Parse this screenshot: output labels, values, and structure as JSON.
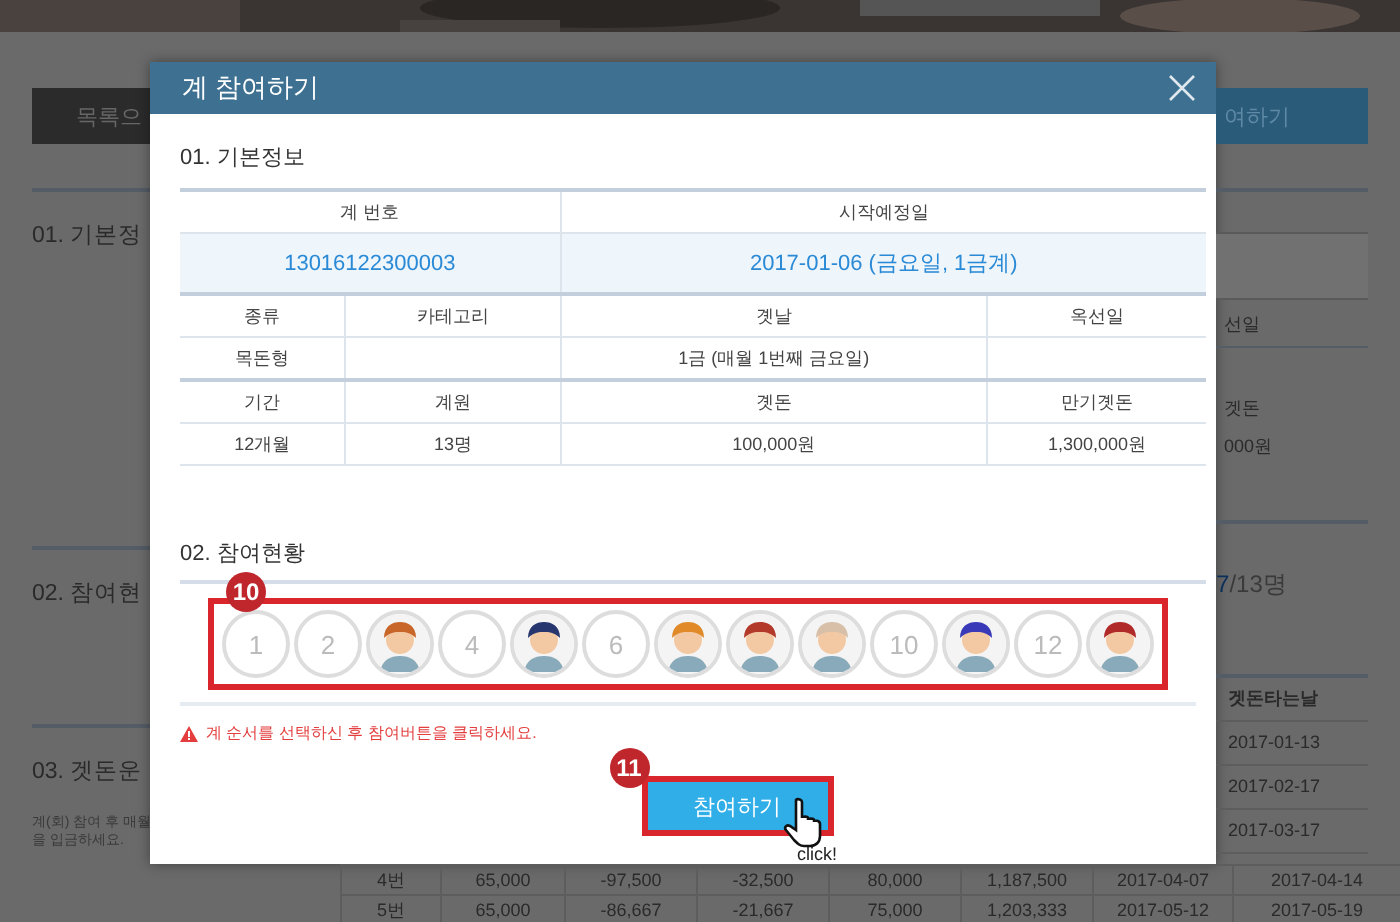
{
  "background_page": {
    "left": {
      "list_button": "목록으",
      "sections": [
        "01. 기본정",
        "02. 참여현",
        "03. 겟돈운"
      ],
      "note": [
        "계(회) 참여 후 매월",
        "을 입금하세요."
      ]
    },
    "right": {
      "join_button": "여하기",
      "labels": [
        "선일",
        "겟돈",
        "000원"
      ],
      "count": {
        "joined": "7",
        "total": "/13명"
      },
      "column_header": "겟돈타는날",
      "dates": [
        "2017-01-13",
        "2017-02-17",
        "2017-03-17"
      ]
    },
    "table_rows": [
      [
        "4번",
        "65,000",
        "-97,500",
        "-32,500",
        "80,000",
        "1,187,500",
        "2017-04-07",
        "2017-04-14"
      ],
      [
        "5번",
        "65,000",
        "-86,667",
        "-21,667",
        "75,000",
        "1,203,333",
        "2017-05-12",
        "2017-05-19"
      ]
    ]
  },
  "modal": {
    "title": "계 참여하기",
    "section_1": "01. 기본정보",
    "info_table": {
      "top_headers": [
        "계 번호",
        "시작예정일"
      ],
      "top_values": [
        "13016122300003",
        "2017-01-06 (금요일, 1금계)"
      ],
      "rows": [
        {
          "kind": "header",
          "cells": [
            "종류",
            "카테고리",
            "곗날",
            "옥선일"
          ]
        },
        {
          "kind": "value",
          "cells": [
            "목돈형",
            "",
            "1금 (매월 1번째 금요일)",
            ""
          ]
        },
        {
          "kind": "header",
          "cells": [
            "기간",
            "계원",
            "곗돈",
            "만기곗돈"
          ]
        },
        {
          "kind": "value",
          "cells": [
            "12개월",
            "13명",
            "100,000원",
            "1,300,000원"
          ]
        }
      ]
    },
    "section_2": "02. 참여현황",
    "step_badge_1": "10",
    "slots": [
      {
        "kind": "number",
        "label": "1"
      },
      {
        "kind": "number",
        "label": "2"
      },
      {
        "kind": "avatar",
        "color": "#c8662a"
      },
      {
        "kind": "number",
        "label": "4"
      },
      {
        "kind": "avatar",
        "color": "#27366e"
      },
      {
        "kind": "number",
        "label": "6"
      },
      {
        "kind": "avatar",
        "color": "#e08a2a"
      },
      {
        "kind": "avatar",
        "color": "#b33a2a"
      },
      {
        "kind": "avatar",
        "color": "#d8c0a8"
      },
      {
        "kind": "number",
        "label": "10"
      },
      {
        "kind": "avatar",
        "color": "#3a3ab8"
      },
      {
        "kind": "number",
        "label": "12"
      },
      {
        "kind": "avatar",
        "color": "#b02a2a"
      }
    ],
    "warning": "계 순서를 선택하신 후 참여버튼을 클릭하세요.",
    "step_badge_2": "11",
    "join_button": "참여하기",
    "click_note": "click!"
  }
}
